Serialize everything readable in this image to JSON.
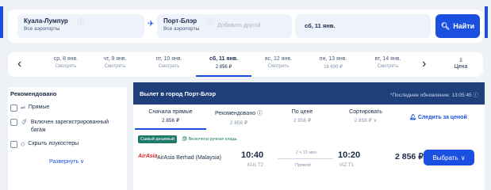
{
  "search": {
    "from_city": "Куала-Лумпур",
    "from_sub": "Все аэропорты",
    "to_city": "Порт-Блэр",
    "to_sub": "Все аэропорты",
    "add_other": "Добавить другой",
    "date": "сб, 11 янв.",
    "find_label": "Найти"
  },
  "dates": [
    {
      "day": "ср, 8 янв.",
      "price": "Смотреть"
    },
    {
      "day": "чт, 9 янв.",
      "price": "Смотреть"
    },
    {
      "day": "пт, 10 янв.",
      "price": "Смотреть"
    },
    {
      "day": "сб, 11 янв.",
      "price": "2 856 ₽"
    },
    {
      "day": "вс, 12 янв.",
      "price": "Смотреть"
    },
    {
      "day": "пн, 13 янв.",
      "price": "18 690 ₽"
    },
    {
      "day": "вт, 14 янв.",
      "price": "Смотреть"
    }
  ],
  "price_toggle": "Цена",
  "filters": {
    "title": "Рекомендовано",
    "items": [
      "Прямые",
      "Включен зарегистрированный багаж",
      "Скрыть лоукостеры"
    ],
    "expand": "Развернуть"
  },
  "results": {
    "title": "Вылет в город Порт-Блэр",
    "updated": "*Последнее обновление: 13:05:45",
    "sort": [
      {
        "label": "Сначала прямые",
        "value": "2 856 ₽"
      },
      {
        "label": "Рекомендовано ⓘ",
        "value": "2 856 ₽"
      },
      {
        "label": "По цене",
        "value": "2 856 ₽"
      },
      {
        "label": "Сортировать",
        "value": "2 856 ₽ ∨"
      }
    ],
    "subscribe": "Следить за ценой",
    "badge_cheapest": "Самый дешевый",
    "badge_baggage": "Включена ручная кладь",
    "logo": "AirAsia",
    "airline": "AirAsia Berhad (Malaysia)",
    "dep_time": "10:40",
    "dep_apt": "KUL T2",
    "duration": "2 ч 10 мин",
    "direct": "Прямой",
    "arr_time": "10:20",
    "arr_apt": "IXZ T1",
    "price": "2 856 ₽",
    "choose": "Выбрать"
  }
}
